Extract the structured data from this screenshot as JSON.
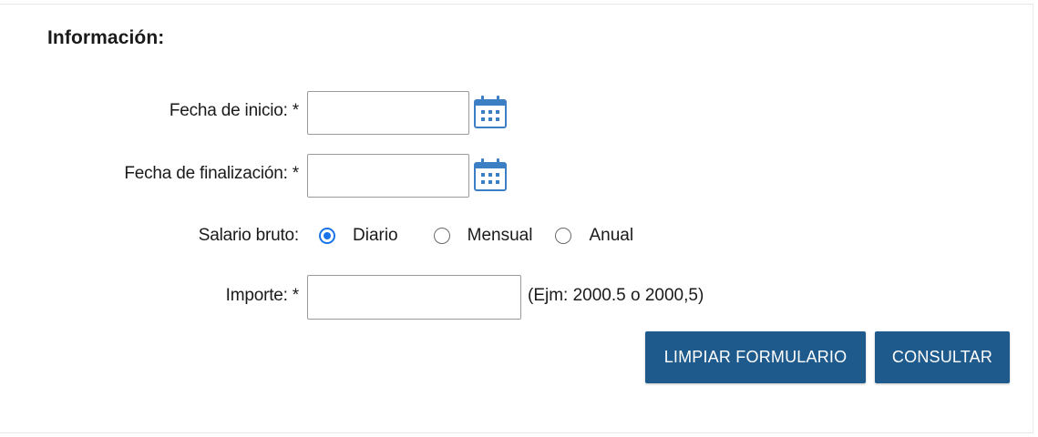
{
  "form": {
    "section_title": "Información:",
    "start_date": {
      "label": "Fecha de inicio: *",
      "value": "",
      "placeholder": ""
    },
    "end_date": {
      "label": "Fecha de finalización: *",
      "value": "",
      "placeholder": ""
    },
    "salary": {
      "label": "Salario bruto:",
      "options": [
        {
          "label": "Diario",
          "checked": true
        },
        {
          "label": "Mensual",
          "checked": false
        },
        {
          "label": "Anual",
          "checked": false
        }
      ]
    },
    "amount": {
      "label": "Importe: *",
      "value": "",
      "placeholder": "",
      "hint": "(Ejm: 2000.5 o 2000,5)"
    },
    "buttons": {
      "clear_label": "LIMPIAR FORMULARIO",
      "submit_label": "CONSULTAR"
    }
  },
  "icons": {
    "calendar": "calendar-icon"
  },
  "colors": {
    "button_bg": "#1f5a8c",
    "button_text": "#ffffff",
    "calendar_icon": "#3d7fc4",
    "radio_checked": "#1a73e8"
  }
}
